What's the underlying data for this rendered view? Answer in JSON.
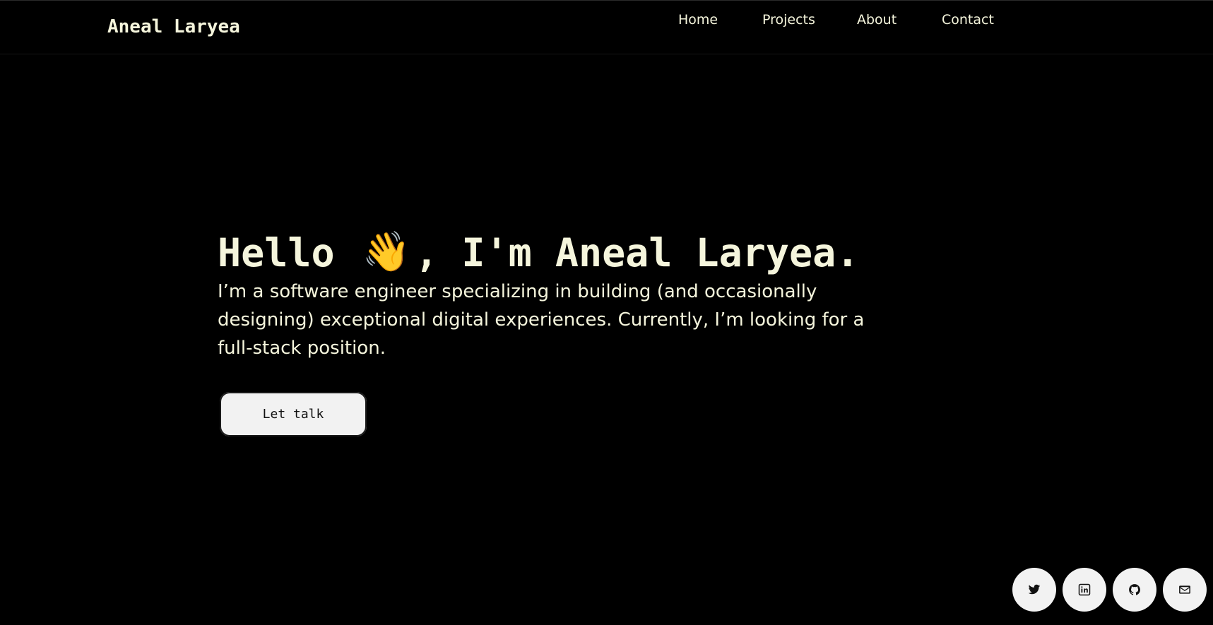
{
  "header": {
    "brand": "Aneal Laryea",
    "nav": [
      {
        "label": "Home"
      },
      {
        "label": "Projects"
      },
      {
        "label": "About"
      },
      {
        "label": "Contact"
      }
    ]
  },
  "hero": {
    "title_pre": "Hello",
    "wave_icon": "👋",
    "title_post": ", I'm Aneal Laryea.",
    "description": "I’m a software engineer specializing in building (and occasionally designing) exceptional digital experiences. Currently, I’m looking for a full-stack position.",
    "cta_label": "Let talk"
  },
  "social": [
    {
      "icon": "twitter-icon"
    },
    {
      "icon": "linkedin-icon"
    },
    {
      "icon": "github-icon"
    },
    {
      "icon": "mail-icon"
    }
  ],
  "colors": {
    "background": "#000000",
    "text": "#f5f5dc",
    "button_bg": "#f2f2f2"
  }
}
